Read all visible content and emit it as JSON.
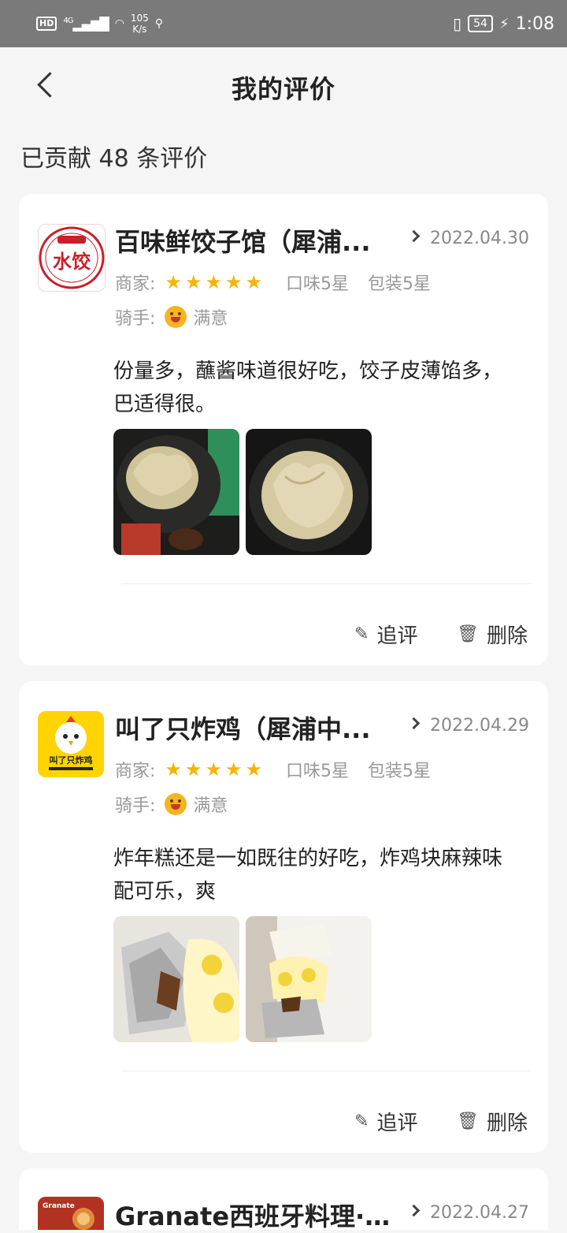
{
  "status_bar": {
    "hd": "HD",
    "network": "4G",
    "speed_value": "105",
    "speed_unit": "K/s",
    "battery": "54",
    "time": "1:08"
  },
  "header": {
    "title": "我的评价"
  },
  "summary": "已贡献 48 条评价",
  "labels": {
    "merchant": "商家:",
    "rider": "骑手:",
    "follow_up": "追评",
    "delete": "删除"
  },
  "reviews": [
    {
      "shop": "百味鲜饺子馆（犀浦...",
      "date": "2022.04.30",
      "logo_text": "水饺",
      "merchant_stars": 5,
      "taste": "口味5星",
      "package": "包装5星",
      "rider_rating": "满意",
      "comment": "份量多，蘸酱味道很好吃，饺子皮薄馅多，巴适得很。",
      "photos": [
        "dumplings-photo-1",
        "dumplings-photo-2"
      ]
    },
    {
      "shop": "叫了只炸鸡（犀浦中...",
      "date": "2022.04.29",
      "logo_text": "叫了只炸鸡",
      "merchant_stars": 5,
      "taste": "口味5星",
      "package": "包装5星",
      "rider_rating": "满意",
      "comment": "炸年糕还是一如既往的好吃，炸鸡块麻辣味配可乐，爽",
      "photos": [
        "fried-chicken-photo-1",
        "fried-chicken-photo-2"
      ]
    },
    {
      "shop": "Granate西班牙料理·...",
      "date": "2022.04.27",
      "logo_text": "Granate"
    }
  ],
  "colors": {
    "star": "#f5b40c",
    "status_bar": "#7a7a7a",
    "background": "#f5f5f5"
  }
}
